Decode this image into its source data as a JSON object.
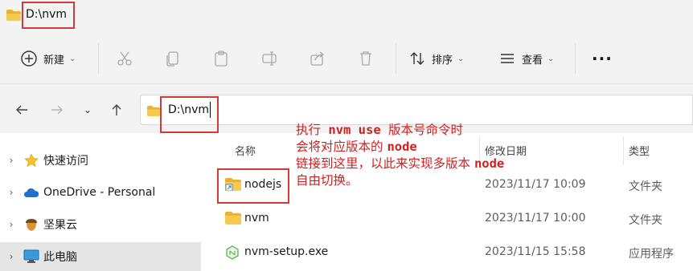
{
  "window": {
    "title": "D:\\nvm"
  },
  "toolbar": {
    "new_label": "新建",
    "sort_label": "排序",
    "view_label": "查看",
    "more_label": "···"
  },
  "navigation": {
    "address": "D:\\nvm"
  },
  "sidebar": {
    "items": [
      {
        "label": "快速访问"
      },
      {
        "label": "OneDrive - Personal"
      },
      {
        "label": "坚果云"
      },
      {
        "label": "此电脑"
      }
    ]
  },
  "file_list": {
    "columns": {
      "name": "名称",
      "modified": "修改日期",
      "type": "类型"
    },
    "rows": [
      {
        "name": "nodejs",
        "modified": "2023/11/17 10:09",
        "type": "文件夹"
      },
      {
        "name": "nvm",
        "modified": "2023/11/17 10:00",
        "type": "文件夹"
      },
      {
        "name": "nvm-setup.exe",
        "modified": "2023/11/15 15:58",
        "type": "应用程序"
      }
    ]
  },
  "annotation": {
    "line1_prefix": "执行",
    "line1_code": " nvm use ",
    "line1_suffix": "版本号命令时",
    "line2_prefix": "会将对应版本的 ",
    "line2_code": "node",
    "line3_prefix": "链接到这里，以此来实现多版本 ",
    "line3_code": "node",
    "line4": "自由切换。",
    "color": "#d21f1f"
  },
  "colors": {
    "highlight_box": "#d23a3a",
    "folder": "#f2c04a"
  }
}
